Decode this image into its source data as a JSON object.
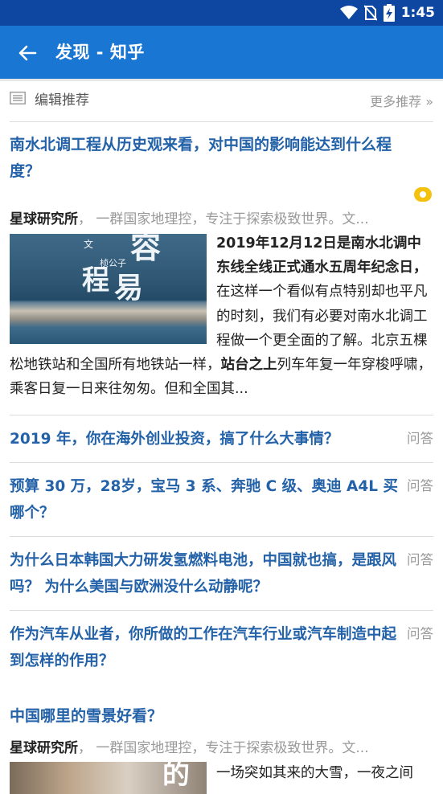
{
  "status_bar": {
    "time": "1:45",
    "icons": [
      "wifi-icon",
      "no-sim-icon",
      "battery-charging-icon"
    ],
    "background": "#0d47a1"
  },
  "app_bar": {
    "title": "发现 - 知乎",
    "back_icon": "back-arrow-icon",
    "background": "#1976d2"
  },
  "section": {
    "icon": "list-icon",
    "label": "编辑推荐",
    "more": "更多推荐 »"
  },
  "featured": {
    "title": "南水北调工程从历史观来看，对中国的影响能达到什么程度？",
    "author": "星球研究所",
    "author_sep": "，",
    "author_bio": "一群国家地理控，专注于探索极致世界。文...",
    "thumb_text": {
      "big1": "程",
      "big2": "容",
      "big3": "易",
      "small1": "文",
      "small2": "桢公子"
    },
    "excerpt_bold1": "2019年12月12日是南水北调中东线全线正式通水五周年纪念日，",
    "excerpt_part1": "在这样一个看似有点特别却也平凡的时刻，我们有必要对南水北调工程做一个更全面的了解。北京五棵松地铁站和全国所有地铁站一样，",
    "excerpt_bold2": "站台之上",
    "excerpt_part2": "列车年复一年穿梭呼啸，乘客日复一日来往匆匆。但和全国其..."
  },
  "questions": [
    {
      "title": "2019 年，你在海外创业投资，搞了什么大事情？",
      "tag": "问答"
    },
    {
      "title": "预算 30 万，28岁，宝马 3 系、奔驰 C 级、奥迪 A4L 买哪个？",
      "tag": "问答"
    },
    {
      "title": "为什么日本韩国大力研发氢燃料电池，中国就也搞，是跟风吗？ 为什么美国与欧洲没什么动静呢？",
      "tag": "问答"
    },
    {
      "title": "作为汽车从业者，你所做的工作在汽车行业或汽车制造中起到怎样的作用？",
      "tag": "问答"
    }
  ],
  "second": {
    "title": "中国哪里的雪景好看？",
    "author": "星球研究所",
    "author_sep": "，",
    "author_bio": "一群国家地理控，专注于探索极致世界。文...",
    "thumb_text": "的",
    "excerpt": "一场突如其来的大雪，一夜之间"
  }
}
